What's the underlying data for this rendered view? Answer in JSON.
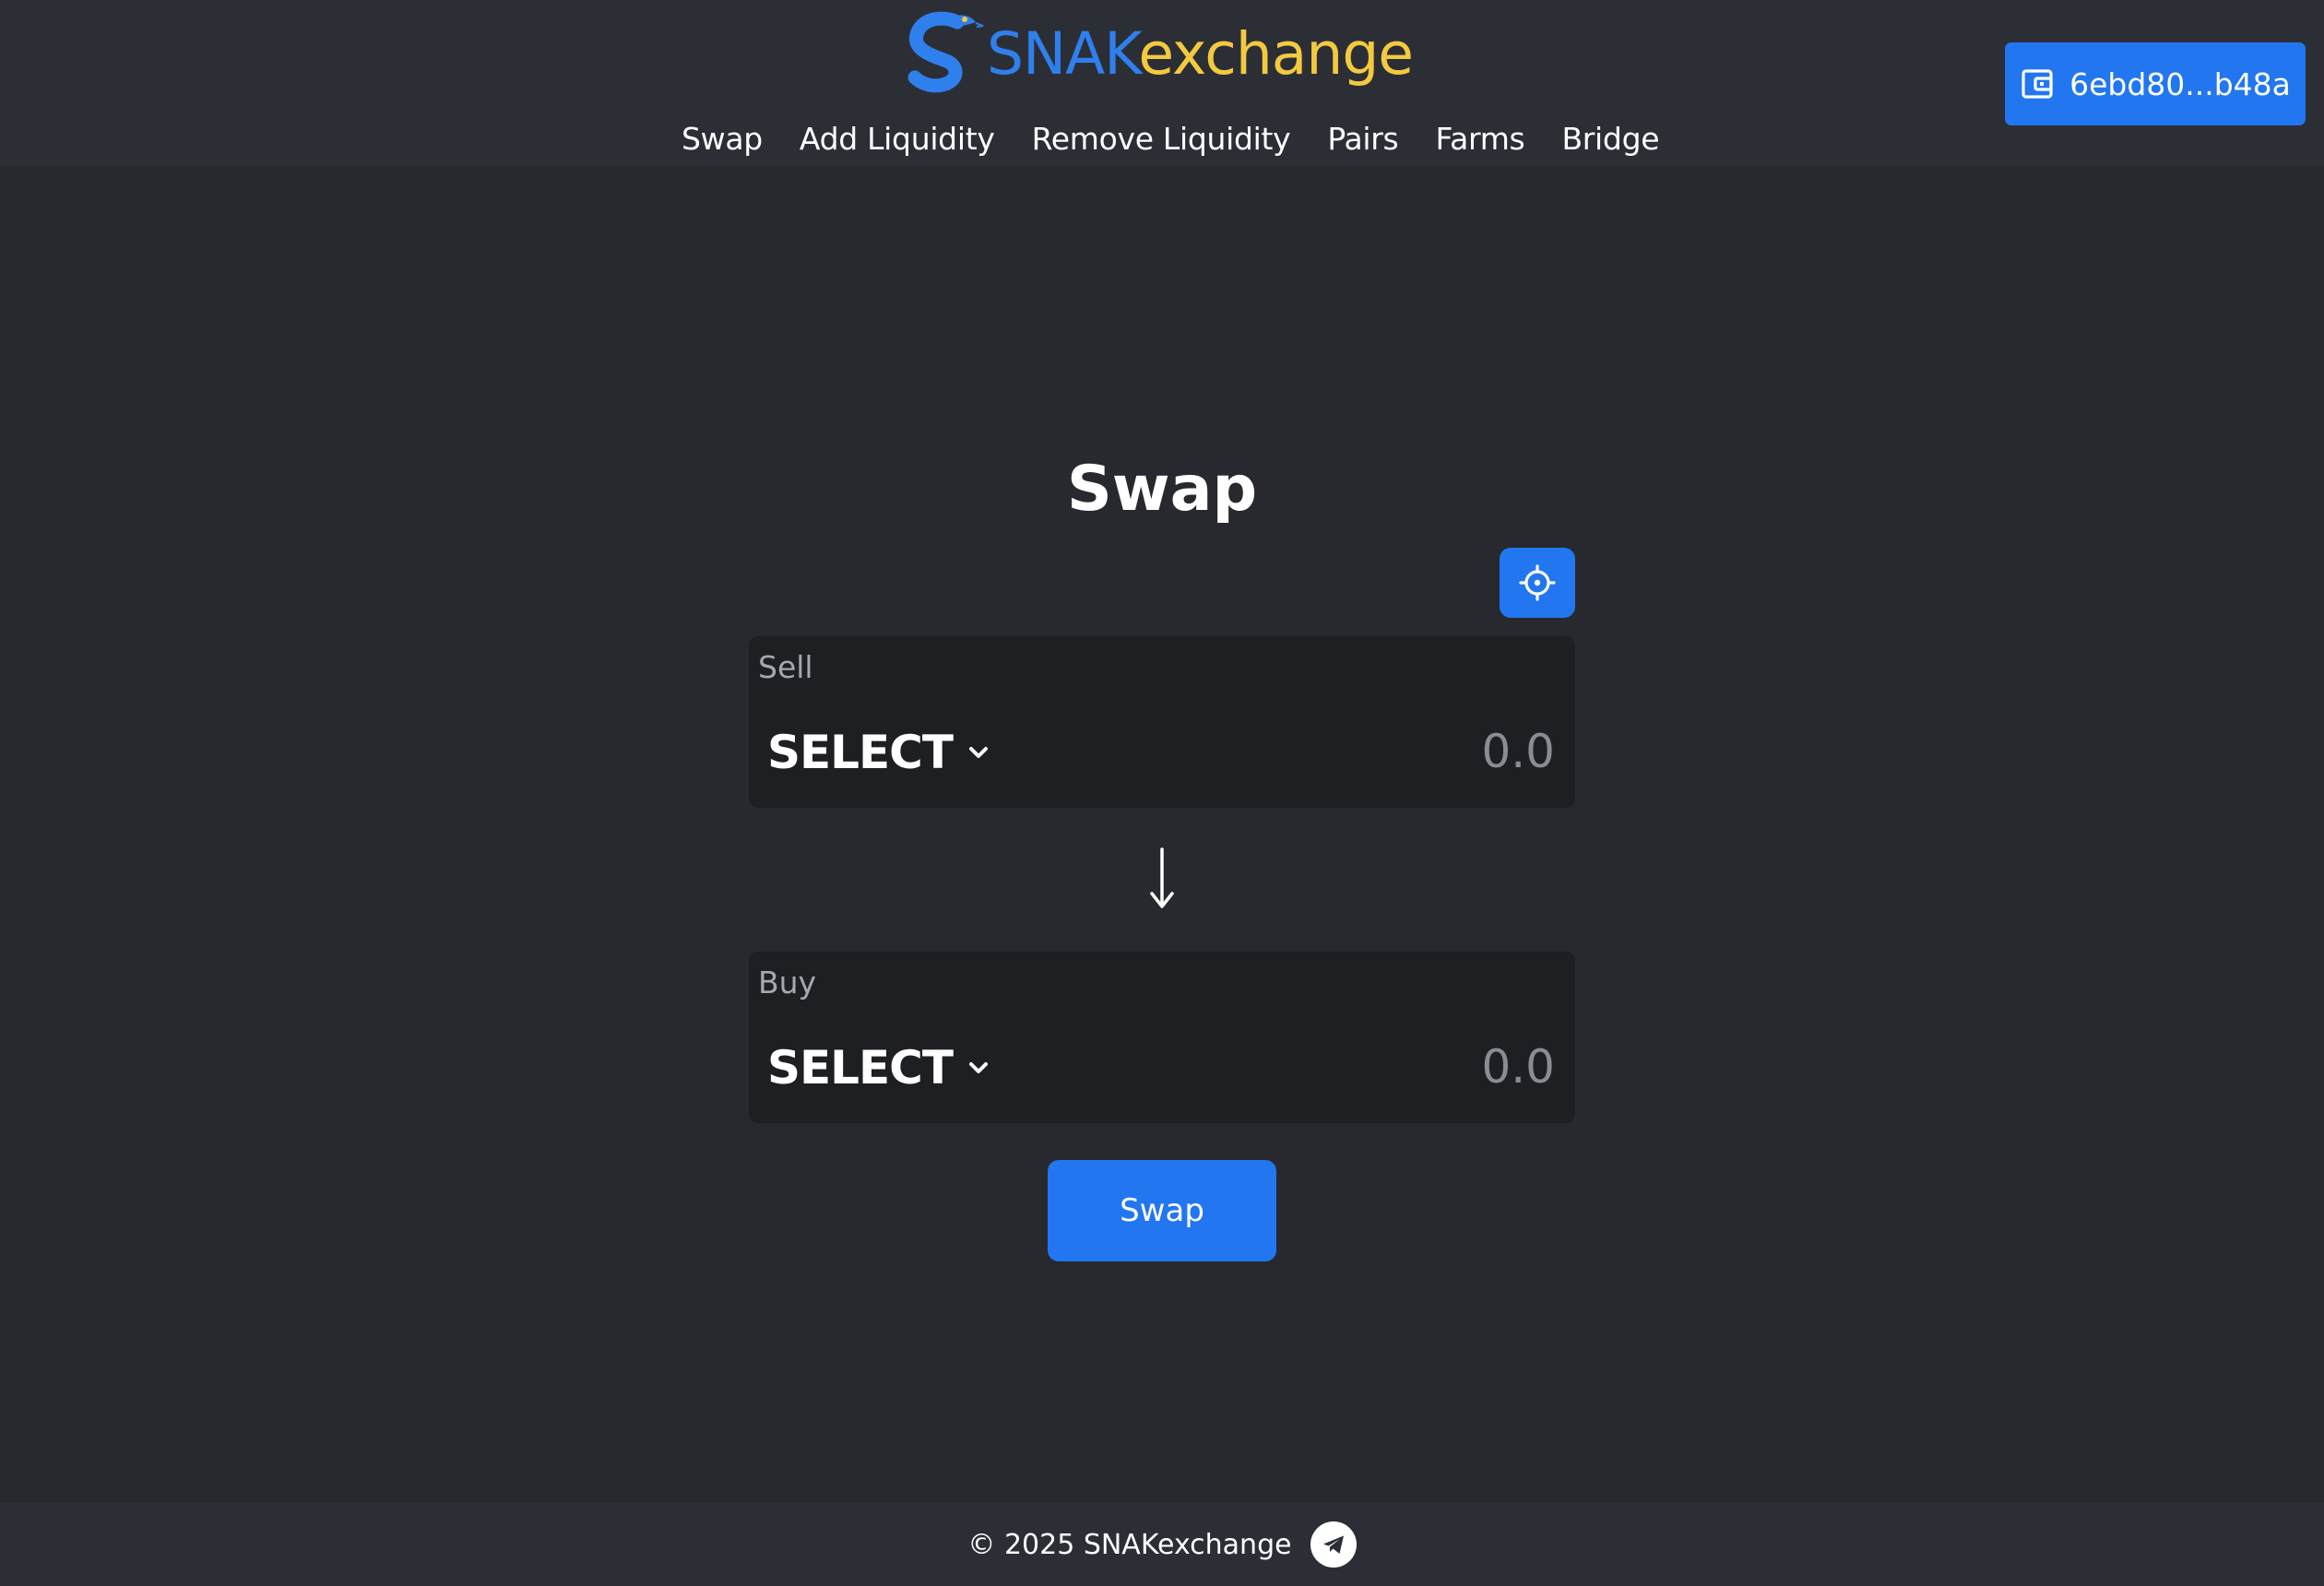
{
  "brand": {
    "logo_icon": "snake-s-icon",
    "name_part_1": "SNAK",
    "name_part_2": "exchange",
    "color_primary": "#2f80ed",
    "color_secondary": "#f3c93f"
  },
  "nav": {
    "items": [
      {
        "label": "Swap"
      },
      {
        "label": "Add Liquidity"
      },
      {
        "label": "Remove Liquidity"
      },
      {
        "label": "Pairs"
      },
      {
        "label": "Farms"
      },
      {
        "label": "Bridge"
      }
    ]
  },
  "wallet": {
    "icon": "wallet-icon",
    "label": "6ebd80...b48a"
  },
  "main": {
    "title": "Swap",
    "settings_icon": "gear-icon",
    "sell": {
      "label": "Sell",
      "token_select": "SELECT",
      "amount_placeholder": "0.0"
    },
    "direction_icon": "arrow-down-icon",
    "buy": {
      "label": "Buy",
      "token_select": "SELECT",
      "amount_placeholder": "0.0"
    },
    "swap_button": "Swap"
  },
  "footer": {
    "copyright": "© 2025 SNAKexchange",
    "social_icon": "telegram-icon"
  },
  "colors": {
    "accent": "#2276f0",
    "background": "#27292e",
    "header_bg": "#2c2e36",
    "panel_bg": "#1e1f23"
  }
}
